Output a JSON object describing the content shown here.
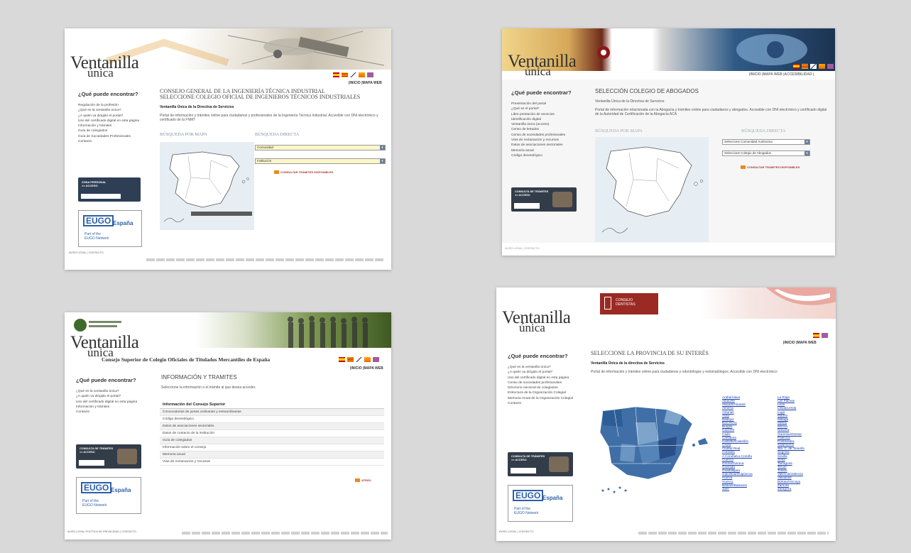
{
  "colors": {
    "bg": "#d9d9da",
    "link": "#1a3fa8",
    "accent": "#e88a1a",
    "map_blue": "#3f6fa6"
  },
  "logo": {
    "line1": "Ventanilla",
    "line2": "única"
  },
  "panel1": {
    "toplinks": "|INICIO  |MAPA WEB",
    "heading": "¿Qué puede encontrar?",
    "menu": [
      "Regulación de la profesión",
      "¿Qué es la ventanilla única?",
      "¿A quién va dirigido el portal?",
      "Uso del certificado digital en esta página",
      "Información y trámites",
      "Guía de colegiados",
      "Guía de Sociedades Profesionales",
      "Contacto"
    ],
    "title1": "CONSEJO GENERAL DE LA INGENIERÍA TÉCNICA INDUSTRIAL",
    "title2": "SELECCIONE COLEGIO OFICIAL DE INGENIEROS TÉCNICOS INDUSTRIALES",
    "sub": "Ventanilla Única de la Directiva de Servicios",
    "desc": "Portal de información y trámites online para ciudadanos y profesionales de la Ingeniería Técnica Industrial. Accesible con DNI electrónico y certificado de la FNMT",
    "map_label": "BÚSQUEDA POR MAPA",
    "direct_label": "BÚSQUEDA DIRECTA",
    "select1": "Comunidad",
    "select2": "Institución",
    "action": "CONSULTAR TRÁMITES DISPONIBLES",
    "promo": "ZONA PERSONAL\n>> ACCESO",
    "eugo": {
      "eu": "EUGO",
      "es": "España",
      "part": "Part of the\nEUGO Network"
    },
    "footer_left": "AVISO LEGAL  |  CONTACTO"
  },
  "panel2": {
    "toplinks": "|INICIO  |MAPA WEB  |ACCESIBILIDAD |",
    "heading": "¿Qué puede encontrar?",
    "menu": [
      "Presentación del portal",
      "¿Qué es el portal?",
      "Libre prestación de servicios",
      "Identificación digital",
      "Ventanilla única (acceso)",
      "Censo de letrados",
      "Censo de sociedades profesionales",
      "Vías de reclamación y recursos",
      "Datos de asociaciones sectoriales",
      "Memoria anual",
      "Código deontológico"
    ],
    "title1": "SELECCIÓN COLEGIO DE ABOGADOS",
    "sub": "Ventanilla Única de la Directiva de Servicios",
    "desc": "Portal de información relacionada con la Abogacía y trámites online para ciudadanos y abogados. Accesible con DNI electrónico y certificado digital de la Autoridad de Certificación de la Abogacía ACA",
    "map_label": "BÚSQUEDA POR MAPA",
    "direct_label": "BÚSQUEDA DIRECTA",
    "select1": "Seleccione Comunidad Autónoma",
    "select2": "Seleccione Colegio de Abogados",
    "action": "CONSULTAR TRÁMITES DISPONIBLES",
    "promo": "CONSULTA DE TRÁMITES\n>> ACCESO",
    "footer_left": "AVISO LEGAL  |  CONTACTO"
  },
  "panel3": {
    "org": "Consejo Superior de Colegio Oficiales de Titulados Mercantiles de España",
    "toplinks": "|INICIO  |MAPA WEB",
    "heading": "¿Qué puede encontrar?",
    "menu": [
      "¿Qué es la ventanilla única?",
      "¿A quién va dirigido el portal?",
      "Uso del certificado digital en esta página",
      "Información y trámites",
      "Contacto"
    ],
    "title1": "INFORMACIÓN Y TRAMITES",
    "intro": "Seleccione la información o el trámite al que desea acceder.",
    "table_head": "Información del Consejo Superior",
    "rows": [
      "Convocatorias de juntas ordinarias y extraordinarias",
      "Código deontológico",
      "Datos de asociaciones sectoriales",
      "Datos de contacto de la institución",
      "Guía de colegiados",
      "Información sobre el consejo",
      "Memoria anual",
      "Vías de reclamación y recursos"
    ],
    "back": "ATRÁS",
    "promo": "CONSULTA DE TRÁMITES\n>> ACCESO",
    "eugo": {
      "eu": "EUGO",
      "es": "España",
      "part": "Part of the\nEUGO Network"
    },
    "footer_left": "AVISO LEGAL POLÍTICA DE PRIVACIDAD  |  CONTACTO"
  },
  "panel4": {
    "toplinks": "|INICIO  |MAPA WEB",
    "heading": "¿Qué puede encontrar?",
    "menu": [
      "¿Qué es la ventanilla única?",
      "¿A quién va dirigido el portal?",
      "Uso del certificado digital en esta página",
      "Censo de sociedades profesionales",
      "Directorio nacional de colegiados",
      "Estructura de la Organización Colegial",
      "Memoria Anual de la Organización Colegial",
      "Contacto"
    ],
    "badge": "CONSEJO\nDENTISTAS",
    "title1": "SELECCIONE LA PROVINCIA DE SU INTERÉS",
    "sub": "Ventanilla Única de la directiva de Servicios",
    "desc": "Portal de información y trámites online para ciudadanos y odontólogos y estomatólogos. Accesible con DNI electrónico",
    "prov_col1": [
      "Araba/Álava",
      "Albacete",
      "Alacant/Alicante",
      "Almería",
      "Asturias",
      "Ávila",
      "Badajoz",
      "Barcelona",
      "Burgos",
      "Cáceres",
      "Cádiz",
      "Cantabria",
      "Castelló/Castellón",
      "Ceuta",
      "Ciudad Real",
      "Córdoba",
      "A Coruña/La Coruña",
      "Cuenca",
      "Girona/Gerona",
      "Granada",
      "Guadalajara",
      "Gipuzkoa/Guipúzcoa",
      "Huelva",
      "Huesca",
      "Balears/Baleares",
      "Jaén"
    ],
    "prov_col2": [
      "La Rioja",
      "Las Palmas",
      "León",
      "Lleida/Lérida",
      "Lugo",
      "Madrid",
      "Málaga",
      "Melilla",
      "Murcia",
      "Navarra",
      "Ourense/Orense",
      "Palencia",
      "Pontevedra",
      "Salamanca",
      "Sta. C. de Tenerife",
      "Segovia",
      "Sevilla",
      "Soria",
      "Tarragona",
      "Teruel",
      "Toledo",
      "València/Valencia",
      "Valladolid",
      "Bizkaia/Vizcaya",
      "Zamora",
      "Zaragoza"
    ],
    "promo": "CONSULTA DE TRÁMITES\n>> ACCESO",
    "eugo": {
      "eu": "EUGO",
      "es": "España",
      "part": "Part of the\nEUGO Network"
    },
    "footer_left": "AVISO LEGAL  |  CONTACTO"
  }
}
